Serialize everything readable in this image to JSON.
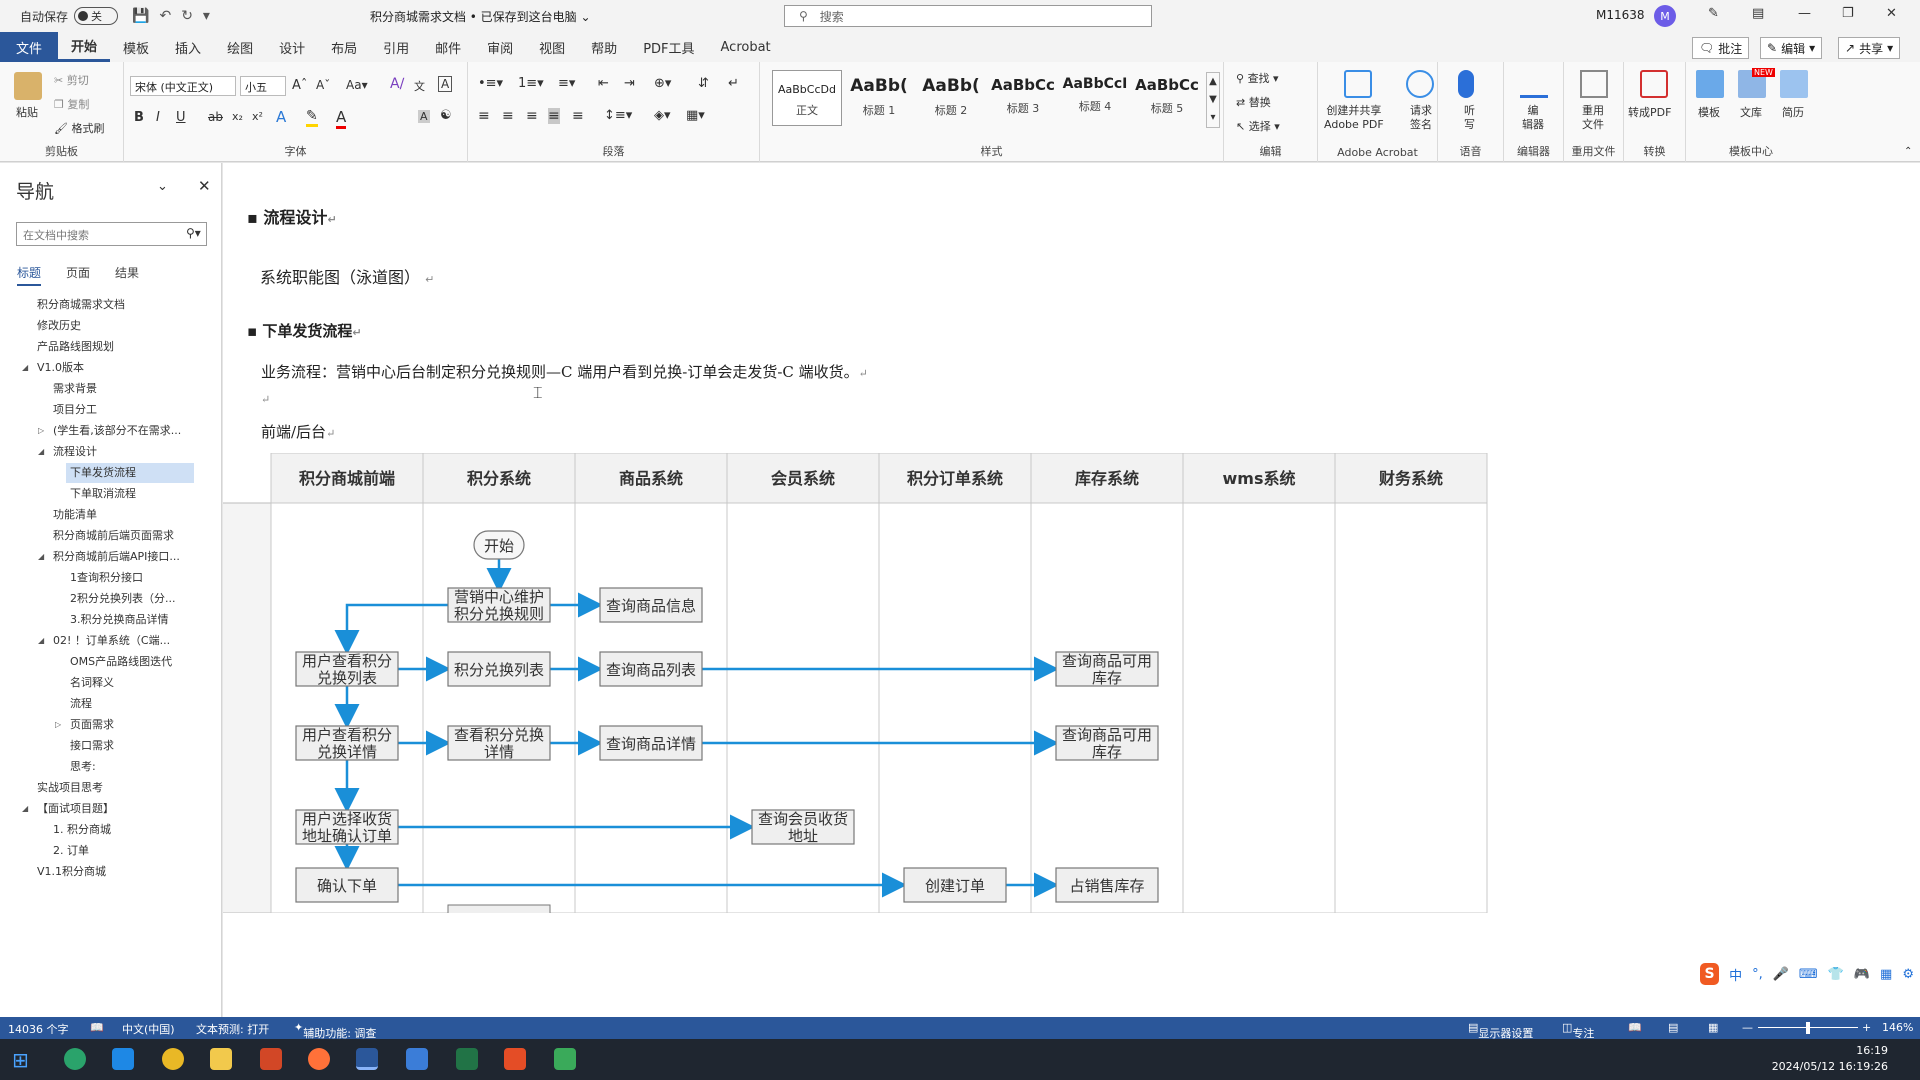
{
  "titlebar": {
    "autosave_label": "自动保存",
    "autosave_state": "关",
    "document_title": "积分商城需求文档 • 已保存到这台电脑",
    "search_placeholder": "搜索",
    "account_name": "M11638",
    "avatar_initial": "M"
  },
  "tabs": [
    "文件",
    "开始",
    "模板",
    "插入",
    "绘图",
    "设计",
    "布局",
    "引用",
    "邮件",
    "审阅",
    "视图",
    "帮助",
    "PDF工具",
    "Acrobat"
  ],
  "ribbon_right": {
    "comment": "批注",
    "edit": "编辑",
    "share": "共享"
  },
  "ribbon": {
    "clipboard": {
      "paste": "粘贴",
      "cut": "剪切",
      "copy": "复制",
      "format_painter": "格式刷",
      "label": "剪贴板"
    },
    "font": {
      "font_name": "宋体 (中文正文)",
      "font_size": "小五",
      "label": "字体"
    },
    "paragraph": {
      "label": "段落"
    },
    "styles": {
      "label": "样式",
      "items": [
        {
          "sample": "AaBbCcDd",
          "name": "正文"
        },
        {
          "sample": "AaBb(",
          "name": "标题 1"
        },
        {
          "sample": "AaBb(",
          "name": "标题 2"
        },
        {
          "sample": "AaBbCc",
          "name": "标题 3"
        },
        {
          "sample": "AaBbCcI",
          "name": "标题 4"
        },
        {
          "sample": "AaBbCc",
          "name": "标题 5"
        }
      ]
    },
    "editing": {
      "find": "查找",
      "replace": "替换",
      "select": "选择",
      "label": "编辑"
    },
    "acrobat": {
      "create_share": "创建并共享",
      "adobe_pdf": "Adobe PDF",
      "request_sign_1": "请求",
      "request_sign_2": "签名",
      "label": "Adobe Acrobat"
    },
    "voice": {
      "dictate_1": "听",
      "dictate_2": "写",
      "label": "语音"
    },
    "editor": {
      "editor_1": "编",
      "editor_2": "辑器",
      "label": "编辑器"
    },
    "reuse": {
      "reuse_1": "重用",
      "reuse_2": "文件",
      "label": "重用文件"
    },
    "convert": {
      "to_pdf": "转成PDF",
      "label": "转换"
    },
    "templates": {
      "template": "模板",
      "library": "文库",
      "resume": "简历",
      "label": "模板中心",
      "new_badge": "NEW"
    }
  },
  "nav": {
    "title": "导航",
    "search_placeholder": "在文档中搜索",
    "tabs": [
      "标题",
      "页面",
      "结果"
    ],
    "items": [
      "积分商城需求文档",
      "修改历史",
      "产品路线图规划",
      "V1.0版本",
      "需求背景",
      "项目分工",
      "(学生看,该部分不在需求...",
      "流程设计",
      "下单发货流程",
      "下单取消流程",
      "功能清单",
      "积分商城前后端页面需求",
      "积分商城前后端API接口...",
      "1查询积分接口",
      "2积分兑换列表（分...",
      "3.积分兑换商品详情",
      "02! ！订单系统（C端...",
      "OMS产品路线图迭代",
      "名词释义",
      "流程",
      "页面需求",
      "接口需求",
      "思考:",
      "实战项目思考",
      "【面试项目题】",
      "1. 积分商城",
      "2. 订单",
      "V1.1积分商城"
    ]
  },
  "document": {
    "h_flow_design": "流程设计",
    "swimlane_title": "系统职能图（泳道图）",
    "h_order_flow": "下单发货流程",
    "business_flow": "业务流程：营销中心后台制定积分兑换规则—C 端用户看到兑换-订单会走发货-C 端收货。",
    "frontend_backend": "前端/后台"
  },
  "chart_data": {
    "type": "swimlane",
    "lanes": [
      "积分商城前端",
      "积分系统",
      "商品系统",
      "会员系统",
      "积分订单系统",
      "库存系统",
      "wms系统",
      "财务系统"
    ],
    "nodes": [
      {
        "id": "start",
        "text": "开始",
        "lane": "积分系统",
        "shape": "rounded"
      },
      {
        "id": "rule",
        "text": "营销中心维护积分兑换规则",
        "lane": "积分系统"
      },
      {
        "id": "q_goods_info",
        "text": "查询商品信息",
        "lane": "商品系统"
      },
      {
        "id": "view_list",
        "text": "用户查看积分兑换列表",
        "lane": "积分商城前端"
      },
      {
        "id": "exchange_list",
        "text": "积分兑换列表",
        "lane": "积分系统"
      },
      {
        "id": "q_goods_list",
        "text": "查询商品列表",
        "lane": "商品系统"
      },
      {
        "id": "q_stock_1",
        "text": "查询商品可用库存",
        "lane": "库存系统"
      },
      {
        "id": "view_detail",
        "text": "用户查看积分兑换详情",
        "lane": "积分商城前端"
      },
      {
        "id": "exchange_detail",
        "text": "查看积分兑换详情",
        "lane": "积分系统"
      },
      {
        "id": "q_goods_detail",
        "text": "查询商品详情",
        "lane": "商品系统"
      },
      {
        "id": "q_stock_2",
        "text": "查询商品可用库存",
        "lane": "库存系统"
      },
      {
        "id": "select_addr",
        "text": "用户选择收货地址确认订单",
        "lane": "积分商城前端"
      },
      {
        "id": "q_member_addr",
        "text": "查询会员收货地址",
        "lane": "会员系统"
      },
      {
        "id": "confirm",
        "text": "确认下单",
        "lane": "积分商城前端"
      },
      {
        "id": "create_order",
        "text": "创建订单",
        "lane": "积分订单系统"
      },
      {
        "id": "occupy_stock",
        "text": "占销售库存",
        "lane": "库存系统"
      }
    ]
  },
  "statusbar": {
    "word_count": "14036 个字",
    "language": "中文(中国)",
    "text_prediction": "文本预测: 打开",
    "accessibility": "辅助功能: 调查",
    "display_settings": "显示器设置",
    "focus": "专注",
    "zoom": "146%"
  },
  "ime": {
    "mode": "中"
  },
  "clock": {
    "time": "16:19",
    "date": "2024/05/12 16:19:26"
  },
  "colors": {
    "accent": "#2b579a",
    "arrow": "#1a8fd8"
  }
}
